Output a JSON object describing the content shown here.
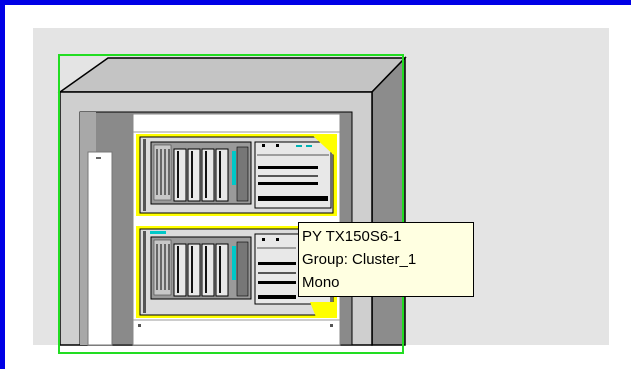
{
  "colors": {
    "window_border": "#0000e6",
    "canvas_background": "#e4e4e4",
    "selection_outline": "#22dd22",
    "server_highlight": "#ffff00",
    "tooltip_background": "#ffffe1"
  },
  "rack": {
    "servers": [
      {
        "name": "server-unit-top",
        "selected": true
      },
      {
        "name": "server-unit-bottom",
        "selected": true
      }
    ]
  },
  "tooltip": {
    "line1": "PY TX150S6-1",
    "line2": "Group: Cluster_1",
    "line3": "Mono"
  }
}
